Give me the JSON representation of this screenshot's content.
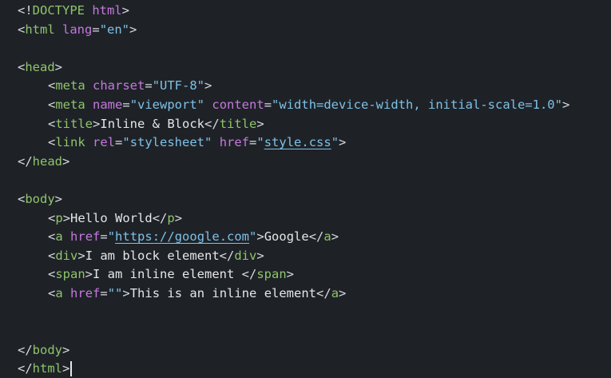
{
  "editor": {
    "lines": [
      [
        {
          "c": "p",
          "v": "<!"
        },
        {
          "c": "t",
          "v": "DOCTYPE"
        },
        {
          "c": "p",
          "v": " "
        },
        {
          "c": "a",
          "v": "html"
        },
        {
          "c": "p",
          "v": ">"
        }
      ],
      [
        {
          "c": "p",
          "v": "<"
        },
        {
          "c": "t",
          "v": "html"
        },
        {
          "c": "p",
          "v": " "
        },
        {
          "c": "a",
          "v": "lang"
        },
        {
          "c": "p",
          "v": "="
        },
        {
          "c": "s",
          "v": "\"en\""
        },
        {
          "c": "p",
          "v": ">"
        }
      ],
      [],
      [
        {
          "c": "p",
          "v": "<"
        },
        {
          "c": "t",
          "v": "head"
        },
        {
          "c": "p",
          "v": ">"
        }
      ],
      [
        {
          "i": 1
        },
        {
          "c": "p",
          "v": "<"
        },
        {
          "c": "t",
          "v": "meta"
        },
        {
          "c": "p",
          "v": " "
        },
        {
          "c": "a",
          "v": "charset"
        },
        {
          "c": "p",
          "v": "="
        },
        {
          "c": "s",
          "v": "\"UTF-8\""
        },
        {
          "c": "p",
          "v": ">"
        }
      ],
      [
        {
          "i": 1
        },
        {
          "c": "p",
          "v": "<"
        },
        {
          "c": "t",
          "v": "meta"
        },
        {
          "c": "p",
          "v": " "
        },
        {
          "c": "a",
          "v": "name"
        },
        {
          "c": "p",
          "v": "="
        },
        {
          "c": "s",
          "v": "\"viewport\""
        },
        {
          "c": "p",
          "v": " "
        },
        {
          "c": "a",
          "v": "content"
        },
        {
          "c": "p",
          "v": "="
        },
        {
          "c": "s",
          "v": "\"width=device-width, initial-scale=1.0\""
        },
        {
          "c": "p",
          "v": ">"
        }
      ],
      [
        {
          "i": 1
        },
        {
          "c": "p",
          "v": "<"
        },
        {
          "c": "t",
          "v": "title"
        },
        {
          "c": "p",
          "v": ">"
        },
        {
          "c": "txt",
          "v": "Inline & Block"
        },
        {
          "c": "p",
          "v": "</"
        },
        {
          "c": "t",
          "v": "title"
        },
        {
          "c": "p",
          "v": ">"
        }
      ],
      [
        {
          "i": 1
        },
        {
          "c": "p",
          "v": "<"
        },
        {
          "c": "t",
          "v": "link"
        },
        {
          "c": "p",
          "v": " "
        },
        {
          "c": "a",
          "v": "rel"
        },
        {
          "c": "p",
          "v": "="
        },
        {
          "c": "s",
          "v": "\"stylesheet\""
        },
        {
          "c": "p",
          "v": " "
        },
        {
          "c": "a",
          "v": "href"
        },
        {
          "c": "p",
          "v": "="
        },
        {
          "c": "s",
          "v": "\""
        },
        {
          "c": "s link",
          "v": "style.css"
        },
        {
          "c": "s",
          "v": "\""
        },
        {
          "c": "p",
          "v": ">"
        }
      ],
      [
        {
          "c": "p",
          "v": "</"
        },
        {
          "c": "t",
          "v": "head"
        },
        {
          "c": "p",
          "v": ">"
        }
      ],
      [],
      [
        {
          "c": "p",
          "v": "<"
        },
        {
          "c": "t",
          "v": "body"
        },
        {
          "c": "p",
          "v": ">"
        }
      ],
      [
        {
          "i": 1
        },
        {
          "c": "p",
          "v": "<"
        },
        {
          "c": "t",
          "v": "p"
        },
        {
          "c": "p",
          "v": ">"
        },
        {
          "c": "txt",
          "v": "Hello World"
        },
        {
          "c": "p",
          "v": "</"
        },
        {
          "c": "t",
          "v": "p"
        },
        {
          "c": "p",
          "v": ">"
        }
      ],
      [
        {
          "i": 1
        },
        {
          "c": "p",
          "v": "<"
        },
        {
          "c": "t",
          "v": "a"
        },
        {
          "c": "p",
          "v": " "
        },
        {
          "c": "a",
          "v": "href"
        },
        {
          "c": "p",
          "v": "="
        },
        {
          "c": "s",
          "v": "\""
        },
        {
          "c": "s link",
          "v": "https://google.com"
        },
        {
          "c": "s",
          "v": "\""
        },
        {
          "c": "p",
          "v": ">"
        },
        {
          "c": "txt",
          "v": "Google"
        },
        {
          "c": "p",
          "v": "</"
        },
        {
          "c": "t",
          "v": "a"
        },
        {
          "c": "p",
          "v": ">"
        }
      ],
      [
        {
          "i": 1
        },
        {
          "c": "p",
          "v": "<"
        },
        {
          "c": "t",
          "v": "div"
        },
        {
          "c": "p",
          "v": ">"
        },
        {
          "c": "txt",
          "v": "I am block element"
        },
        {
          "c": "p",
          "v": "</"
        },
        {
          "c": "t",
          "v": "div"
        },
        {
          "c": "p",
          "v": ">"
        }
      ],
      [
        {
          "i": 1
        },
        {
          "c": "p",
          "v": "<"
        },
        {
          "c": "t",
          "v": "span"
        },
        {
          "c": "p",
          "v": ">"
        },
        {
          "c": "txt",
          "v": "I am inline element "
        },
        {
          "c": "p",
          "v": "</"
        },
        {
          "c": "t",
          "v": "span"
        },
        {
          "c": "p",
          "v": ">"
        }
      ],
      [
        {
          "i": 1
        },
        {
          "c": "p",
          "v": "<"
        },
        {
          "c": "t",
          "v": "a"
        },
        {
          "c": "p",
          "v": " "
        },
        {
          "c": "a",
          "v": "href"
        },
        {
          "c": "p",
          "v": "="
        },
        {
          "c": "s",
          "v": "\"\""
        },
        {
          "c": "p",
          "v": ">"
        },
        {
          "c": "txt",
          "v": "This is an inline element"
        },
        {
          "c": "p",
          "v": "</"
        },
        {
          "c": "t",
          "v": "a"
        },
        {
          "c": "p",
          "v": ">"
        }
      ],
      [],
      [],
      [
        {
          "c": "p",
          "v": "</"
        },
        {
          "c": "t",
          "v": "body"
        },
        {
          "c": "p",
          "v": ">"
        }
      ],
      [
        {
          "c": "p",
          "v": "</"
        },
        {
          "c": "t",
          "v": "html"
        },
        {
          "c": "p",
          "v": ">"
        },
        {
          "cursor": true
        }
      ]
    ]
  }
}
